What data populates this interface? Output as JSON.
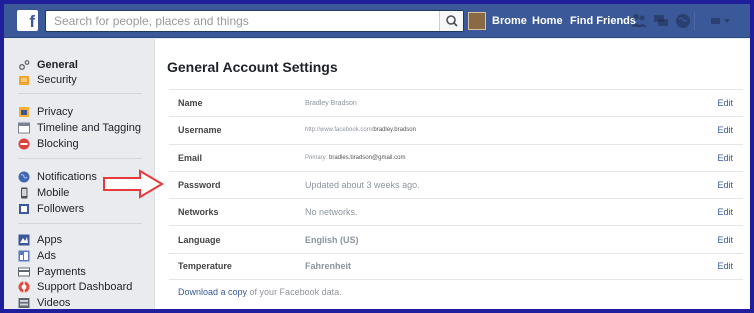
{
  "search": {
    "placeholder": "Search for people, places and things"
  },
  "topnav": {
    "profile": "Brome",
    "home": "Home",
    "find_friends": "Find Friends"
  },
  "sidebar": {
    "items": [
      {
        "label": "General",
        "icon": "gear-icon"
      },
      {
        "label": "Security",
        "icon": "shield-icon"
      },
      {
        "label": "Privacy",
        "icon": "lock-icon"
      },
      {
        "label": "Timeline and Tagging",
        "icon": "timeline-icon"
      },
      {
        "label": "Blocking",
        "icon": "blocking-icon"
      },
      {
        "label": "Notifications",
        "icon": "globe-icon"
      },
      {
        "label": "Mobile",
        "icon": "mobile-icon"
      },
      {
        "label": "Followers",
        "icon": "followers-icon"
      },
      {
        "label": "Apps",
        "icon": "apps-icon"
      },
      {
        "label": "Ads",
        "icon": "ads-icon"
      },
      {
        "label": "Payments",
        "icon": "payments-icon"
      },
      {
        "label": "Support Dashboard",
        "icon": "support-icon"
      },
      {
        "label": "Videos",
        "icon": "videos-icon"
      }
    ]
  },
  "main": {
    "title": "General Account Settings",
    "rows": [
      {
        "label": "Name",
        "value": "Bradley Bradson",
        "edit": "Edit"
      },
      {
        "label": "Username",
        "value_prefix": "http://www.facebook.com/",
        "value_strong": "bradley.bradson",
        "edit": "Edit"
      },
      {
        "label": "Email",
        "value_prefix": "Primary: ",
        "value_strong": "bradles.bradson@gmail.com",
        "edit": "Edit"
      },
      {
        "label": "Password",
        "value": "Updated about 3 weeks ago.",
        "edit": "Edit"
      },
      {
        "label": "Networks",
        "value": "No networks.",
        "edit": "Edit"
      },
      {
        "label": "Language",
        "value": "English (US)",
        "edit": "Edit"
      },
      {
        "label": "Temperature",
        "value": "Fahrenheit",
        "edit": "Edit"
      }
    ],
    "download_link": "Download a copy",
    "download_suffix": " of your Facebook data."
  },
  "colors": {
    "brand": "#3b5998",
    "link": "#365899",
    "arrow": "#e8383c",
    "frame": "#1f1f9e"
  }
}
